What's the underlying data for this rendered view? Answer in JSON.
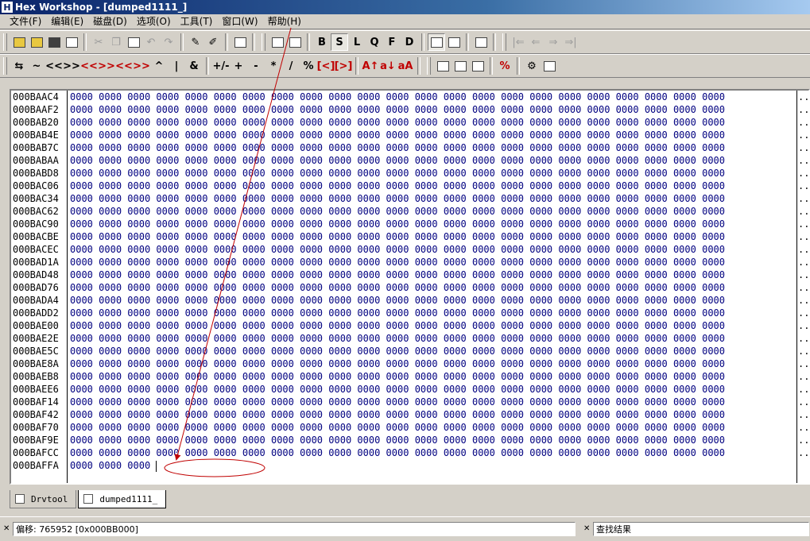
{
  "window": {
    "title": "Hex Workshop - [dumped1111_]",
    "icon": "H"
  },
  "menu": [
    "文件(F)",
    "编辑(E)",
    "磁盘(D)",
    "选项(O)",
    "工具(T)",
    "窗口(W)",
    "帮助(H)"
  ],
  "toolbar1": {
    "bold_labels": [
      "B",
      "S",
      "L",
      "Q",
      "F",
      "D"
    ],
    "nav_glyphs": [
      "|⇐",
      "⇐",
      "⇒",
      "⇒|"
    ]
  },
  "toolbar2": {
    "glyphs": [
      "⇆",
      "~",
      "<<",
      ">>",
      "<<",
      ">>",
      "<<",
      ">>",
      "^",
      "|",
      "&",
      "+/-",
      "+",
      "-",
      "*",
      "/",
      "%",
      "[<]",
      "[>]",
      "A↑",
      "a↓",
      "aA"
    ]
  },
  "editor": {
    "rows": [
      {
        "addr": "000BAAC4",
        "words": [
          "0000",
          "0000",
          "0000",
          "0000",
          "0000",
          "0000",
          "0000",
          "0000",
          "0000",
          "0000",
          "0000",
          "0000",
          "0000",
          "0000",
          "0000",
          "0000",
          "0000",
          "0000",
          "0000",
          "0000",
          "0000",
          "0000",
          "0000"
        ]
      },
      {
        "addr": "000BAAF2",
        "words": [
          "0000",
          "0000",
          "0000",
          "0000",
          "0000",
          "0000",
          "0000",
          "0000",
          "0000",
          "0000",
          "0000",
          "0000",
          "0000",
          "0000",
          "0000",
          "0000",
          "0000",
          "0000",
          "0000",
          "0000",
          "0000",
          "0000",
          "0000"
        ]
      },
      {
        "addr": "000BAB20",
        "words": [
          "0000",
          "0000",
          "0000",
          "0000",
          "0000",
          "0000",
          "0000",
          "0000",
          "0000",
          "0000",
          "0000",
          "0000",
          "0000",
          "0000",
          "0000",
          "0000",
          "0000",
          "0000",
          "0000",
          "0000",
          "0000",
          "0000",
          "0000"
        ]
      },
      {
        "addr": "000BAB4E",
        "words": [
          "0000",
          "0000",
          "0000",
          "0000",
          "0000",
          "0000",
          "0000",
          "0000",
          "0000",
          "0000",
          "0000",
          "0000",
          "0000",
          "0000",
          "0000",
          "0000",
          "0000",
          "0000",
          "0000",
          "0000",
          "0000",
          "0000",
          "0000"
        ]
      },
      {
        "addr": "000BAB7C",
        "words": [
          "0000",
          "0000",
          "0000",
          "0000",
          "0000",
          "0000",
          "0000",
          "0000",
          "0000",
          "0000",
          "0000",
          "0000",
          "0000",
          "0000",
          "0000",
          "0000",
          "0000",
          "0000",
          "0000",
          "0000",
          "0000",
          "0000",
          "0000"
        ]
      },
      {
        "addr": "000BABAA",
        "words": [
          "0000",
          "0000",
          "0000",
          "0000",
          "0000",
          "0000",
          "0000",
          "0000",
          "0000",
          "0000",
          "0000",
          "0000",
          "0000",
          "0000",
          "0000",
          "0000",
          "0000",
          "0000",
          "0000",
          "0000",
          "0000",
          "0000",
          "0000"
        ]
      },
      {
        "addr": "000BABD8",
        "words": [
          "0000",
          "0000",
          "0000",
          "0000",
          "0000",
          "0000",
          "0000",
          "0000",
          "0000",
          "0000",
          "0000",
          "0000",
          "0000",
          "0000",
          "0000",
          "0000",
          "0000",
          "0000",
          "0000",
          "0000",
          "0000",
          "0000",
          "0000"
        ]
      },
      {
        "addr": "000BAC06",
        "words": [
          "0000",
          "0000",
          "0000",
          "0000",
          "0000",
          "0000",
          "0000",
          "0000",
          "0000",
          "0000",
          "0000",
          "0000",
          "0000",
          "0000",
          "0000",
          "0000",
          "0000",
          "0000",
          "0000",
          "0000",
          "0000",
          "0000",
          "0000"
        ]
      },
      {
        "addr": "000BAC34",
        "words": [
          "0000",
          "0000",
          "0000",
          "0000",
          "0000",
          "0000",
          "0000",
          "0000",
          "0000",
          "0000",
          "0000",
          "0000",
          "0000",
          "0000",
          "0000",
          "0000",
          "0000",
          "0000",
          "0000",
          "0000",
          "0000",
          "0000",
          "0000"
        ]
      },
      {
        "addr": "000BAC62",
        "words": [
          "0000",
          "0000",
          "0000",
          "0000",
          "0000",
          "0000",
          "0000",
          "0000",
          "0000",
          "0000",
          "0000",
          "0000",
          "0000",
          "0000",
          "0000",
          "0000",
          "0000",
          "0000",
          "0000",
          "0000",
          "0000",
          "0000",
          "0000"
        ]
      },
      {
        "addr": "000BAC90",
        "words": [
          "0000",
          "0000",
          "0000",
          "0000",
          "0000",
          "0000",
          "0000",
          "0000",
          "0000",
          "0000",
          "0000",
          "0000",
          "0000",
          "0000",
          "0000",
          "0000",
          "0000",
          "0000",
          "0000",
          "0000",
          "0000",
          "0000",
          "0000"
        ]
      },
      {
        "addr": "000BACBE",
        "words": [
          "0000",
          "0000",
          "0000",
          "0000",
          "0000",
          "0000",
          "0000",
          "0000",
          "0000",
          "0000",
          "0000",
          "0000",
          "0000",
          "0000",
          "0000",
          "0000",
          "0000",
          "0000",
          "0000",
          "0000",
          "0000",
          "0000",
          "0000"
        ]
      },
      {
        "addr": "000BACEC",
        "words": [
          "0000",
          "0000",
          "0000",
          "0000",
          "0000",
          "0000",
          "0000",
          "0000",
          "0000",
          "0000",
          "0000",
          "0000",
          "0000",
          "0000",
          "0000",
          "0000",
          "0000",
          "0000",
          "0000",
          "0000",
          "0000",
          "0000",
          "0000"
        ]
      },
      {
        "addr": "000BAD1A",
        "words": [
          "0000",
          "0000",
          "0000",
          "0000",
          "0000",
          "0000",
          "0000",
          "0000",
          "0000",
          "0000",
          "0000",
          "0000",
          "0000",
          "0000",
          "0000",
          "0000",
          "0000",
          "0000",
          "0000",
          "0000",
          "0000",
          "0000",
          "0000"
        ]
      },
      {
        "addr": "000BAD48",
        "words": [
          "0000",
          "0000",
          "0000",
          "0000",
          "0000",
          "0000",
          "0000",
          "0000",
          "0000",
          "0000",
          "0000",
          "0000",
          "0000",
          "0000",
          "0000",
          "0000",
          "0000",
          "0000",
          "0000",
          "0000",
          "0000",
          "0000",
          "0000"
        ]
      },
      {
        "addr": "000BAD76",
        "words": [
          "0000",
          "0000",
          "0000",
          "0000",
          "0000",
          "0000",
          "0000",
          "0000",
          "0000",
          "0000",
          "0000",
          "0000",
          "0000",
          "0000",
          "0000",
          "0000",
          "0000",
          "0000",
          "0000",
          "0000",
          "0000",
          "0000",
          "0000"
        ]
      },
      {
        "addr": "000BADA4",
        "words": [
          "0000",
          "0000",
          "0000",
          "0000",
          "0000",
          "0000",
          "0000",
          "0000",
          "0000",
          "0000",
          "0000",
          "0000",
          "0000",
          "0000",
          "0000",
          "0000",
          "0000",
          "0000",
          "0000",
          "0000",
          "0000",
          "0000",
          "0000"
        ]
      },
      {
        "addr": "000BADD2",
        "words": [
          "0000",
          "0000",
          "0000",
          "0000",
          "0000",
          "0000",
          "0000",
          "0000",
          "0000",
          "0000",
          "0000",
          "0000",
          "0000",
          "0000",
          "0000",
          "0000",
          "0000",
          "0000",
          "0000",
          "0000",
          "0000",
          "0000",
          "0000"
        ]
      },
      {
        "addr": "000BAE00",
        "words": [
          "0000",
          "0000",
          "0000",
          "0000",
          "0000",
          "0000",
          "0000",
          "0000",
          "0000",
          "0000",
          "0000",
          "0000",
          "0000",
          "0000",
          "0000",
          "0000",
          "0000",
          "0000",
          "0000",
          "0000",
          "0000",
          "0000",
          "0000"
        ]
      },
      {
        "addr": "000BAE2E",
        "words": [
          "0000",
          "0000",
          "0000",
          "0000",
          "0000",
          "0000",
          "0000",
          "0000",
          "0000",
          "0000",
          "0000",
          "0000",
          "0000",
          "0000",
          "0000",
          "0000",
          "0000",
          "0000",
          "0000",
          "0000",
          "0000",
          "0000",
          "0000"
        ]
      },
      {
        "addr": "000BAE5C",
        "words": [
          "0000",
          "0000",
          "0000",
          "0000",
          "0000",
          "0000",
          "0000",
          "0000",
          "0000",
          "0000",
          "0000",
          "0000",
          "0000",
          "0000",
          "0000",
          "0000",
          "0000",
          "0000",
          "0000",
          "0000",
          "0000",
          "0000",
          "0000"
        ]
      },
      {
        "addr": "000BAE8A",
        "words": [
          "0000",
          "0000",
          "0000",
          "0000",
          "0000",
          "0000",
          "0000",
          "0000",
          "0000",
          "0000",
          "0000",
          "0000",
          "0000",
          "0000",
          "0000",
          "0000",
          "0000",
          "0000",
          "0000",
          "0000",
          "0000",
          "0000",
          "0000"
        ]
      },
      {
        "addr": "000BAEB8",
        "words": [
          "0000",
          "0000",
          "0000",
          "0000",
          "0000",
          "0000",
          "0000",
          "0000",
          "0000",
          "0000",
          "0000",
          "0000",
          "0000",
          "0000",
          "0000",
          "0000",
          "0000",
          "0000",
          "0000",
          "0000",
          "0000",
          "0000",
          "0000"
        ]
      },
      {
        "addr": "000BAEE6",
        "words": [
          "0000",
          "0000",
          "0000",
          "0000",
          "0000",
          "0000",
          "0000",
          "0000",
          "0000",
          "0000",
          "0000",
          "0000",
          "0000",
          "0000",
          "0000",
          "0000",
          "0000",
          "0000",
          "0000",
          "0000",
          "0000",
          "0000",
          "0000"
        ]
      },
      {
        "addr": "000BAF14",
        "words": [
          "0000",
          "0000",
          "0000",
          "0000",
          "0000",
          "0000",
          "0000",
          "0000",
          "0000",
          "0000",
          "0000",
          "0000",
          "0000",
          "0000",
          "0000",
          "0000",
          "0000",
          "0000",
          "0000",
          "0000",
          "0000",
          "0000",
          "0000"
        ]
      },
      {
        "addr": "000BAF42",
        "words": [
          "0000",
          "0000",
          "0000",
          "0000",
          "0000",
          "0000",
          "0000",
          "0000",
          "0000",
          "0000",
          "0000",
          "0000",
          "0000",
          "0000",
          "0000",
          "0000",
          "0000",
          "0000",
          "0000",
          "0000",
          "0000",
          "0000",
          "0000"
        ]
      },
      {
        "addr": "000BAF70",
        "words": [
          "0000",
          "0000",
          "0000",
          "0000",
          "0000",
          "0000",
          "0000",
          "0000",
          "0000",
          "0000",
          "0000",
          "0000",
          "0000",
          "0000",
          "0000",
          "0000",
          "0000",
          "0000",
          "0000",
          "0000",
          "0000",
          "0000",
          "0000"
        ]
      },
      {
        "addr": "000BAF9E",
        "words": [
          "0000",
          "0000",
          "0000",
          "0000",
          "0000",
          "0000",
          "0000",
          "0000",
          "0000",
          "0000",
          "0000",
          "0000",
          "0000",
          "0000",
          "0000",
          "0000",
          "0000",
          "0000",
          "0000",
          "0000",
          "0000",
          "0000",
          "0000"
        ]
      },
      {
        "addr": "000BAFCC",
        "words": [
          "0000",
          "0000",
          "0000",
          "0000",
          "0000",
          "0000",
          "0000",
          "0000",
          "0000",
          "0000",
          "0000",
          "0000",
          "0000",
          "0000",
          "0000",
          "0000",
          "0000",
          "0000",
          "0000",
          "0000",
          "0000",
          "0000",
          "0000"
        ]
      },
      {
        "addr": "000BAFFA",
        "words": [
          "0000",
          "0000",
          "0000"
        ]
      }
    ],
    "ascii_glyph": ".."
  },
  "tabs": [
    {
      "label": "Drvtool",
      "active": false
    },
    {
      "label": "dumped1111_",
      "active": true
    }
  ],
  "status": {
    "offset_text": "偏移: 765952 [0x000BB000]",
    "find_results": "查找结果"
  },
  "colors": {
    "hex_text": "#000080",
    "annotation": "#c00000",
    "title_bar": "#0a246a"
  }
}
